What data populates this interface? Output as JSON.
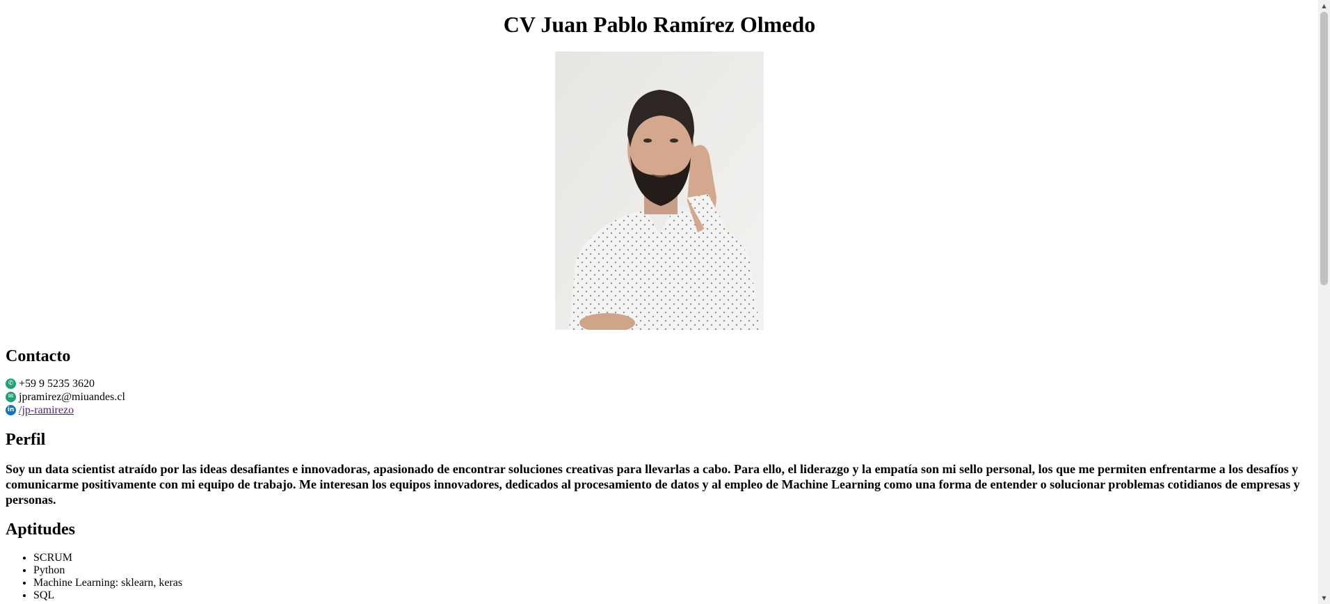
{
  "header": {
    "title": "CV Juan Pablo Ramírez Olmedo"
  },
  "photo": {
    "alt": "Juan Pablo Ramírez Olmedo"
  },
  "contact": {
    "heading": "Contacto",
    "phone": "+59 9 5235 3620",
    "email": "jpramirez@miuandes.cl",
    "linkedin": "/jp-ramirezo",
    "icons": {
      "phone": "phone-icon",
      "email": "email-icon",
      "linkedin": "linkedin-icon"
    }
  },
  "profile": {
    "heading": "Perfil",
    "text": "Soy un data scientist atraído por las ideas desafiantes e innovadoras, apasionado de encontrar soluciones creativas para llevarlas a cabo. Para ello, el liderazgo y la empatía son mi sello personal, los que me permiten enfrentarme a los desafíos y comunicarme positivamente con mi equipo de trabajo. Me interesan los equipos innovadores, dedicados al procesamiento de datos y al empleo de Machine Learning como una forma de entender o solucionar problemas cotidianos de empresas y personas."
  },
  "skills": {
    "heading": "Aptitudes",
    "items": [
      "SCRUM",
      "Python",
      "Machine Learning: sklearn, keras",
      "SQL"
    ]
  },
  "colors": {
    "icon_green": "#1aa37a",
    "icon_blue": "#1175b8",
    "visited_link": "#551a8b"
  }
}
